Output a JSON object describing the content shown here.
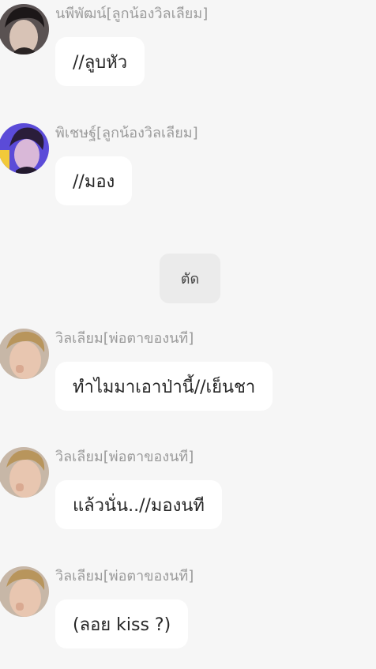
{
  "messages": [
    {
      "sender": "นพีพัฒน์[ลูกน้องวิลเลียม]",
      "text": "//ลูบหัว",
      "avatar": "avatar-dark-hair"
    },
    {
      "sender": "พิเชษฐ์[ลูกน้องวิลเลียม]",
      "text": "//มอง",
      "avatar": "avatar-purple-light"
    },
    {
      "system": "ตัด"
    },
    {
      "sender": "วิลเลียม[พ่อตาของนที]",
      "text": "ทำไมมาเอาป่านี้//เย็นชา",
      "avatar": "avatar-blond"
    },
    {
      "sender": "วิลเลียม[พ่อตาของนที]",
      "text": "แล้วนั่น..//มองนที",
      "avatar": "avatar-blond"
    },
    {
      "sender": "วิลเลียม[พ่อตาของนที]",
      "text": "(ลอย kiss ?)",
      "avatar": "avatar-blond"
    }
  ]
}
